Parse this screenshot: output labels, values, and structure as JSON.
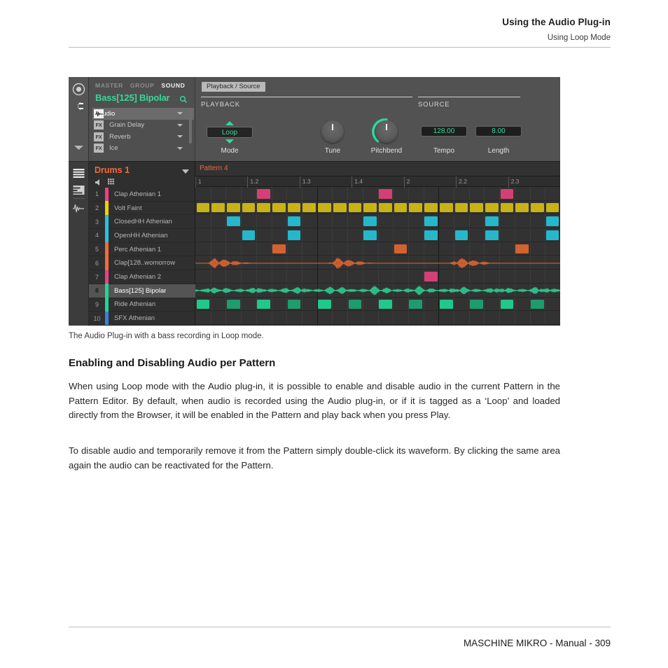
{
  "header": {
    "title": "Using the Audio Plug-in",
    "subtitle": "Using Loop Mode"
  },
  "footer": {
    "text": "MASCHINE MIKRO - Manual - 309"
  },
  "caption": "The Audio Plug-in with a bass recording in Loop mode.",
  "section": {
    "heading": "Enabling and Disabling Audio per Pattern",
    "paragraph1": "When using Loop mode with the Audio plug-in, it is possible to enable and disable audio in the current Pattern in the Pattern Editor. By default, when audio is recorded using the Audio plug-in, or if it is tagged as a ‘Loop’ and loaded directly from the Browser, it will be enabled in the Pattern and play back when you press Play.",
    "paragraph2": "To disable audio and temporarily remove it from the Pattern simply double-click its waveform. By clicking the same area again the audio can be reactivated for the Pattern."
  },
  "plugin": {
    "rail": {
      "icons": [
        "record-circle-icon",
        "plug-icon",
        "collapse-down-icon",
        "arrange-view-icon",
        "mixer-view-icon",
        "waveform-view-icon"
      ]
    },
    "control_area": {
      "level_tabs": [
        {
          "label": "MASTER",
          "active": false
        },
        {
          "label": "GROUP",
          "active": false
        },
        {
          "label": "SOUND",
          "active": true
        }
      ],
      "sound_name": "Bass[125] Bipolar",
      "search_icon": "magnifier-icon",
      "slots": [
        {
          "badge": "wave",
          "name": "Audio",
          "selected": true
        },
        {
          "badge": "FX",
          "name": "Grain Delay",
          "selected": false
        },
        {
          "badge": "FX",
          "name": "Reverb",
          "selected": false
        },
        {
          "badge": "FX",
          "name": "Ice",
          "selected": false
        }
      ]
    },
    "parameters": {
      "page_tab": "Playback / Source",
      "playback_section": "PLAYBACK",
      "source_section": "SOURCE",
      "mode": {
        "label": "Mode",
        "value": "Loop"
      },
      "tune": {
        "label": "Tune",
        "value": ""
      },
      "pitchbend": {
        "label": "Pitchbend",
        "value": ""
      },
      "tempo": {
        "label": "Tempo",
        "value": "128.00"
      },
      "length": {
        "label": "Length",
        "value": "8.00"
      }
    }
  },
  "pattern_editor": {
    "group_name": "Drums 1",
    "group_icons": [
      "speaker-icon",
      "pad-grid-icon"
    ],
    "pattern_name": "Pattern 4",
    "ruler_ticks": [
      "1",
      "1.2",
      "1.3",
      "1.4",
      "2",
      "2.2",
      "2.3"
    ],
    "sounds": [
      {
        "index": "1",
        "name": "Clap Athenian 1",
        "color": "#ee3f85",
        "selected": false
      },
      {
        "index": "2",
        "name": "Volt Faint",
        "color": "#f2d000",
        "selected": false
      },
      {
        "index": "3",
        "name": "ClosedHH Athenian",
        "color": "#25c3e0",
        "selected": false
      },
      {
        "index": "4",
        "name": "OpenHH Athenian",
        "color": "#25c3e0",
        "selected": false
      },
      {
        "index": "5",
        "name": "Perc Athenian 1",
        "color": "#f26b3a",
        "selected": false
      },
      {
        "index": "6",
        "name": "Clap[128..womorrow",
        "color": "#f26b3a",
        "selected": false
      },
      {
        "index": "7",
        "name": "Clap Athenian 2",
        "color": "#ee3f85",
        "selected": false
      },
      {
        "index": "8",
        "name": "Bass[125] Bipolar",
        "color": "#20d694",
        "selected": true
      },
      {
        "index": "9",
        "name": "Ride Athenian",
        "color": "#20d694",
        "selected": false
      },
      {
        "index": "10",
        "name": "SFX Athenian",
        "color": "#3a7fe0",
        "selected": false
      }
    ],
    "lanes": [
      {
        "type": "steps",
        "color": "#d44076",
        "steps": [
          4,
          12,
          20
        ]
      },
      {
        "type": "steps",
        "color": "#c9b215",
        "steps": [
          0,
          1,
          2,
          3,
          4,
          5,
          6,
          7,
          8,
          9,
          10,
          11,
          12,
          13,
          14,
          15,
          16,
          17,
          18,
          19,
          20,
          21,
          22,
          23
        ]
      },
      {
        "type": "steps",
        "color": "#25b8cc",
        "steps": [
          2,
          6,
          11,
          15,
          19,
          23
        ]
      },
      {
        "type": "steps",
        "color": "#25b8cc",
        "steps": [
          3,
          6,
          11,
          15,
          17,
          19,
          23
        ]
      },
      {
        "type": "steps",
        "color": "#d4622f",
        "steps": [
          5,
          13,
          21
        ]
      },
      {
        "type": "waveform",
        "color": "#d4622f"
      },
      {
        "type": "steps",
        "color": "#d44076",
        "steps": [
          15
        ]
      },
      {
        "type": "waveform",
        "color": "#2cc68c"
      },
      {
        "type": "steps",
        "color": "#20c98b",
        "steps": [
          0,
          2,
          4,
          6,
          8,
          10,
          12,
          14,
          16,
          18,
          20,
          22
        ]
      },
      {
        "type": "steps",
        "color": "#3a7fe0",
        "steps": []
      }
    ]
  }
}
